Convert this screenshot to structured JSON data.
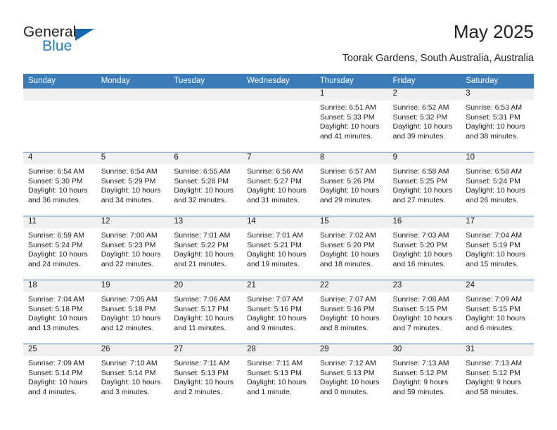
{
  "brand": {
    "name_top": "General",
    "name_bottom": "Blue",
    "flag_color": "#1567b0",
    "text_color": "#231f20",
    "blue_color": "#1f7bc1"
  },
  "header": {
    "title": "May 2025",
    "location": "Toorak Gardens, South Australia, Australia"
  },
  "theme": {
    "header_row_bg": "#3b7cb8",
    "header_row_text": "#ffffff",
    "daynum_band_bg": "#f0f0f0",
    "row_divider": "#3b7cb8"
  },
  "weekdays": [
    "Sunday",
    "Monday",
    "Tuesday",
    "Wednesday",
    "Thursday",
    "Friday",
    "Saturday"
  ],
  "labels": {
    "sunrise_prefix": "Sunrise: ",
    "sunset_prefix": "Sunset: ",
    "daylight_prefix": "Daylight: "
  },
  "weeks": [
    [
      {
        "empty": true
      },
      {
        "empty": true
      },
      {
        "empty": true
      },
      {
        "empty": true
      },
      {
        "day": "1",
        "sunrise": "Sunrise: 6:51 AM",
        "sunset": "Sunset: 5:33 PM",
        "daylight_line1": "Daylight: 10 hours",
        "daylight_line2": "and 41 minutes."
      },
      {
        "day": "2",
        "sunrise": "Sunrise: 6:52 AM",
        "sunset": "Sunset: 5:32 PM",
        "daylight_line1": "Daylight: 10 hours",
        "daylight_line2": "and 39 minutes."
      },
      {
        "day": "3",
        "sunrise": "Sunrise: 6:53 AM",
        "sunset": "Sunset: 5:31 PM",
        "daylight_line1": "Daylight: 10 hours",
        "daylight_line2": "and 38 minutes."
      }
    ],
    [
      {
        "day": "4",
        "sunrise": "Sunrise: 6:54 AM",
        "sunset": "Sunset: 5:30 PM",
        "daylight_line1": "Daylight: 10 hours",
        "daylight_line2": "and 36 minutes."
      },
      {
        "day": "5",
        "sunrise": "Sunrise: 6:54 AM",
        "sunset": "Sunset: 5:29 PM",
        "daylight_line1": "Daylight: 10 hours",
        "daylight_line2": "and 34 minutes."
      },
      {
        "day": "6",
        "sunrise": "Sunrise: 6:55 AM",
        "sunset": "Sunset: 5:28 PM",
        "daylight_line1": "Daylight: 10 hours",
        "daylight_line2": "and 32 minutes."
      },
      {
        "day": "7",
        "sunrise": "Sunrise: 6:56 AM",
        "sunset": "Sunset: 5:27 PM",
        "daylight_line1": "Daylight: 10 hours",
        "daylight_line2": "and 31 minutes."
      },
      {
        "day": "8",
        "sunrise": "Sunrise: 6:57 AM",
        "sunset": "Sunset: 5:26 PM",
        "daylight_line1": "Daylight: 10 hours",
        "daylight_line2": "and 29 minutes."
      },
      {
        "day": "9",
        "sunrise": "Sunrise: 6:58 AM",
        "sunset": "Sunset: 5:25 PM",
        "daylight_line1": "Daylight: 10 hours",
        "daylight_line2": "and 27 minutes."
      },
      {
        "day": "10",
        "sunrise": "Sunrise: 6:58 AM",
        "sunset": "Sunset: 5:24 PM",
        "daylight_line1": "Daylight: 10 hours",
        "daylight_line2": "and 26 minutes."
      }
    ],
    [
      {
        "day": "11",
        "sunrise": "Sunrise: 6:59 AM",
        "sunset": "Sunset: 5:24 PM",
        "daylight_line1": "Daylight: 10 hours",
        "daylight_line2": "and 24 minutes."
      },
      {
        "day": "12",
        "sunrise": "Sunrise: 7:00 AM",
        "sunset": "Sunset: 5:23 PM",
        "daylight_line1": "Daylight: 10 hours",
        "daylight_line2": "and 22 minutes."
      },
      {
        "day": "13",
        "sunrise": "Sunrise: 7:01 AM",
        "sunset": "Sunset: 5:22 PM",
        "daylight_line1": "Daylight: 10 hours",
        "daylight_line2": "and 21 minutes."
      },
      {
        "day": "14",
        "sunrise": "Sunrise: 7:01 AM",
        "sunset": "Sunset: 5:21 PM",
        "daylight_line1": "Daylight: 10 hours",
        "daylight_line2": "and 19 minutes."
      },
      {
        "day": "15",
        "sunrise": "Sunrise: 7:02 AM",
        "sunset": "Sunset: 5:20 PM",
        "daylight_line1": "Daylight: 10 hours",
        "daylight_line2": "and 18 minutes."
      },
      {
        "day": "16",
        "sunrise": "Sunrise: 7:03 AM",
        "sunset": "Sunset: 5:20 PM",
        "daylight_line1": "Daylight: 10 hours",
        "daylight_line2": "and 16 minutes."
      },
      {
        "day": "17",
        "sunrise": "Sunrise: 7:04 AM",
        "sunset": "Sunset: 5:19 PM",
        "daylight_line1": "Daylight: 10 hours",
        "daylight_line2": "and 15 minutes."
      }
    ],
    [
      {
        "day": "18",
        "sunrise": "Sunrise: 7:04 AM",
        "sunset": "Sunset: 5:18 PM",
        "daylight_line1": "Daylight: 10 hours",
        "daylight_line2": "and 13 minutes."
      },
      {
        "day": "19",
        "sunrise": "Sunrise: 7:05 AM",
        "sunset": "Sunset: 5:18 PM",
        "daylight_line1": "Daylight: 10 hours",
        "daylight_line2": "and 12 minutes."
      },
      {
        "day": "20",
        "sunrise": "Sunrise: 7:06 AM",
        "sunset": "Sunset: 5:17 PM",
        "daylight_line1": "Daylight: 10 hours",
        "daylight_line2": "and 11 minutes."
      },
      {
        "day": "21",
        "sunrise": "Sunrise: 7:07 AM",
        "sunset": "Sunset: 5:16 PM",
        "daylight_line1": "Daylight: 10 hours",
        "daylight_line2": "and 9 minutes."
      },
      {
        "day": "22",
        "sunrise": "Sunrise: 7:07 AM",
        "sunset": "Sunset: 5:16 PM",
        "daylight_line1": "Daylight: 10 hours",
        "daylight_line2": "and 8 minutes."
      },
      {
        "day": "23",
        "sunrise": "Sunrise: 7:08 AM",
        "sunset": "Sunset: 5:15 PM",
        "daylight_line1": "Daylight: 10 hours",
        "daylight_line2": "and 7 minutes."
      },
      {
        "day": "24",
        "sunrise": "Sunrise: 7:09 AM",
        "sunset": "Sunset: 5:15 PM",
        "daylight_line1": "Daylight: 10 hours",
        "daylight_line2": "and 6 minutes."
      }
    ],
    [
      {
        "day": "25",
        "sunrise": "Sunrise: 7:09 AM",
        "sunset": "Sunset: 5:14 PM",
        "daylight_line1": "Daylight: 10 hours",
        "daylight_line2": "and 4 minutes."
      },
      {
        "day": "26",
        "sunrise": "Sunrise: 7:10 AM",
        "sunset": "Sunset: 5:14 PM",
        "daylight_line1": "Daylight: 10 hours",
        "daylight_line2": "and 3 minutes."
      },
      {
        "day": "27",
        "sunrise": "Sunrise: 7:11 AM",
        "sunset": "Sunset: 5:13 PM",
        "daylight_line1": "Daylight: 10 hours",
        "daylight_line2": "and 2 minutes."
      },
      {
        "day": "28",
        "sunrise": "Sunrise: 7:11 AM",
        "sunset": "Sunset: 5:13 PM",
        "daylight_line1": "Daylight: 10 hours",
        "daylight_line2": "and 1 minute."
      },
      {
        "day": "29",
        "sunrise": "Sunrise: 7:12 AM",
        "sunset": "Sunset: 5:13 PM",
        "daylight_line1": "Daylight: 10 hours",
        "daylight_line2": "and 0 minutes."
      },
      {
        "day": "30",
        "sunrise": "Sunrise: 7:13 AM",
        "sunset": "Sunset: 5:12 PM",
        "daylight_line1": "Daylight: 9 hours",
        "daylight_line2": "and 59 minutes."
      },
      {
        "day": "31",
        "sunrise": "Sunrise: 7:13 AM",
        "sunset": "Sunset: 5:12 PM",
        "daylight_line1": "Daylight: 9 hours",
        "daylight_line2": "and 58 minutes."
      }
    ]
  ]
}
